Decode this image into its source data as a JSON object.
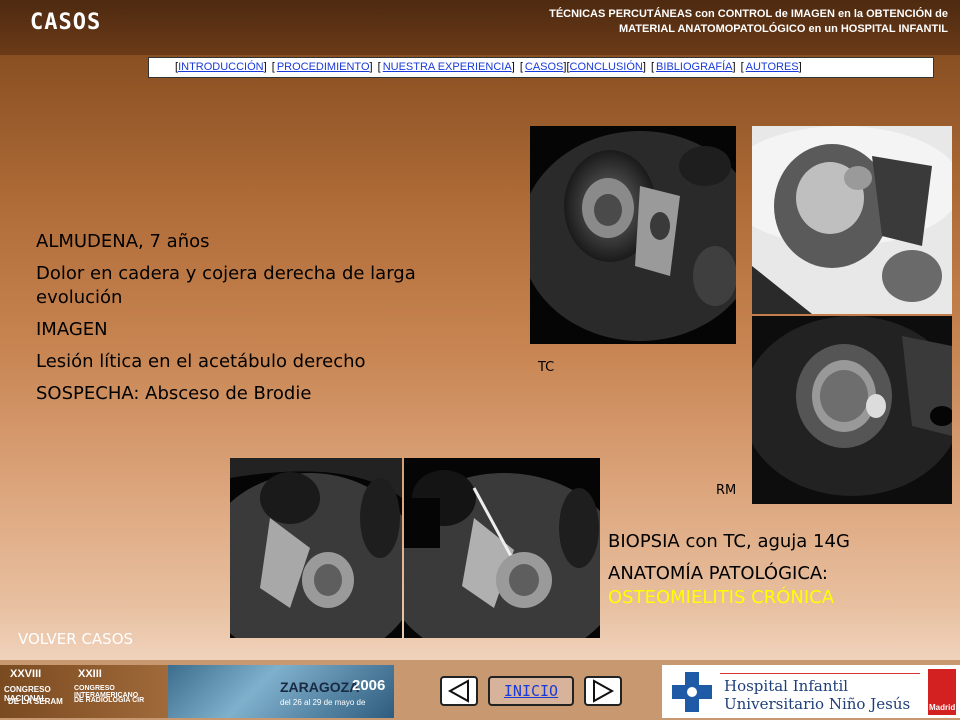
{
  "header": {
    "title": "CASOS",
    "description_line1": "TÉCNICAS PERCUTÁNEAS con CONTROL de IMAGEN en la OBTENCIÓN de",
    "description_line2": "MATERIAL ANATOMOPATOLÓGICO en un HOSPITAL INFANTIL"
  },
  "nav": {
    "items": [
      {
        "label": "INTRODUCCIÓN"
      },
      {
        "label": "PROCEDIMIENTO"
      },
      {
        "label": "NUESTRA EXPERIENCIA"
      },
      {
        "label": "CASOS"
      },
      {
        "label": "CONCLUSIÓN"
      },
      {
        "label": "BIBLIOGRAFÍA"
      },
      {
        "label": "AUTORES"
      }
    ]
  },
  "case": {
    "patient": "ALMUDENA, 7 años",
    "symptoms": "Dolor en cadera y cojera derecha de larga evolución",
    "imaging_heading": "IMAGEN",
    "imaging_finding": "Lesión lítica en el acetábulo derecho",
    "suspicion": "SOSPECHA: Absceso de Brodie"
  },
  "images": {
    "ct_label": "TC",
    "mr_label": "RM"
  },
  "result": {
    "biopsy": "BIOPSIA con TC, aguja 14G",
    "pathology_label": "ANATOMÍA PATOLÓGICA:",
    "diagnosis": "OSTEOMIELITIS CRÓNICA"
  },
  "footer": {
    "back_link": "VOLVER CASOS",
    "home_button": "INICIO",
    "congress_line1": "XXVIII",
    "congress_line2": "CONGRESO NACIONAL",
    "congress_line3": "DE LA SERAM",
    "congress_line4": "XXIII",
    "congress_line5": "CONGRESO INTERAMERICANO",
    "congress_line6": "DE RADIOLOGÍA CIR",
    "city": "ZARAGOZA",
    "year": "2006",
    "dates": "del 26 al 29 de mayo de",
    "hospital_line1": "Hospital Infantil",
    "hospital_line2": "Universitario Niño Jesús",
    "region": "Madrid"
  },
  "colors": {
    "diagnosis": "#ffff00",
    "link": "#1a3ad8"
  }
}
